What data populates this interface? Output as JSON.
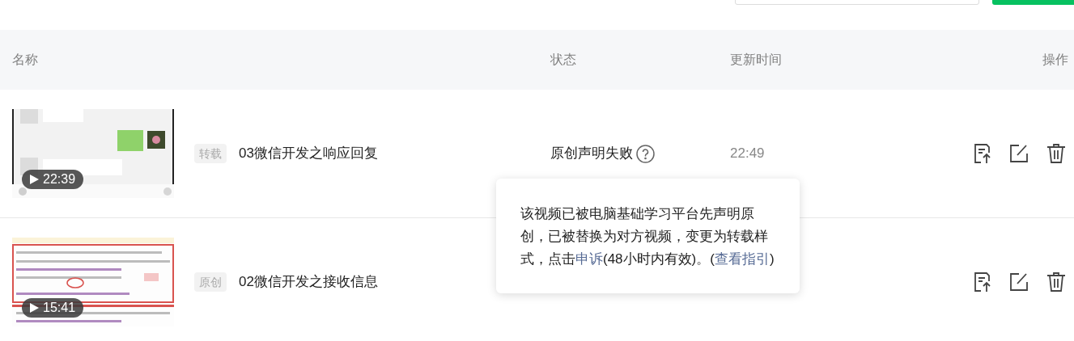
{
  "columns": [
    {
      "label": "名称"
    },
    {
      "label": "状态"
    },
    {
      "label": "更新时间"
    },
    {
      "label": "操作"
    }
  ],
  "rows": [
    {
      "duration": "22:39",
      "tag": "转载",
      "title": "03微信开发之响应回复",
      "status": "原创声明失败",
      "status_help": true,
      "time": "22:49"
    },
    {
      "duration": "15:41",
      "tag": "原创",
      "title": "02微信开发之接收信息"
    }
  ],
  "tooltip": {
    "parts": [
      {
        "kind": "text",
        "text": "该视频已被电脑基础学习平台先声明原创，已被替换为对方视频，变更为转载样式，点击"
      },
      {
        "kind": "link",
        "text": "申诉"
      },
      {
        "kind": "text",
        "text": "(48小时内有效)。("
      },
      {
        "kind": "link",
        "text": "查看指引"
      },
      {
        "kind": "text",
        "text": ")"
      }
    ]
  }
}
